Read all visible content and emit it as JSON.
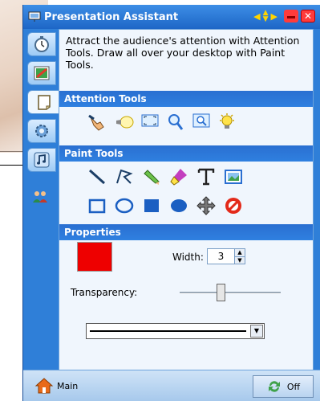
{
  "window": {
    "title": "Presentation Assistant"
  },
  "sidebar": {
    "tabs": [
      {
        "name": "timer-tab",
        "icon": "stopwatch-icon"
      },
      {
        "name": "paint-tab",
        "icon": "paint-palette-icon"
      },
      {
        "name": "notes-tab",
        "icon": "notebook-icon"
      },
      {
        "name": "settings-tab",
        "icon": "gear-icon"
      },
      {
        "name": "music-tab",
        "icon": "music-note-icon"
      },
      {
        "name": "users-tab",
        "icon": "users-icon"
      }
    ]
  },
  "content": {
    "intro": "Attract the audience's attention with Attention Tools. Draw all over your desktop with Paint Tools.",
    "attention_tools": {
      "heading": "Attention Tools",
      "tools": [
        "pointing-hand-icon",
        "spotlight-icon",
        "frame-icon",
        "magnifier-icon",
        "zoom-icon",
        "light-bulb-icon"
      ]
    },
    "paint_tools": {
      "heading": "Paint Tools",
      "row1": [
        "line-icon",
        "polyline-icon",
        "pencil-icon",
        "highlighter-icon",
        "text-icon",
        "image-icon"
      ],
      "row2": [
        "rectangle-outline-icon",
        "ellipse-outline-icon",
        "filled-rectangle-icon",
        "filled-ellipse-icon",
        "move-icon",
        "erase-all-icon"
      ]
    },
    "properties": {
      "heading": "Properties",
      "color": "#ee0000",
      "width_label": "Width:",
      "width_value": "3",
      "transparency_label": "Transparency:",
      "transparency_level": 0.4,
      "line_style": "solid"
    }
  },
  "bottombar": {
    "main_label": "Main",
    "off_label": "Off"
  }
}
